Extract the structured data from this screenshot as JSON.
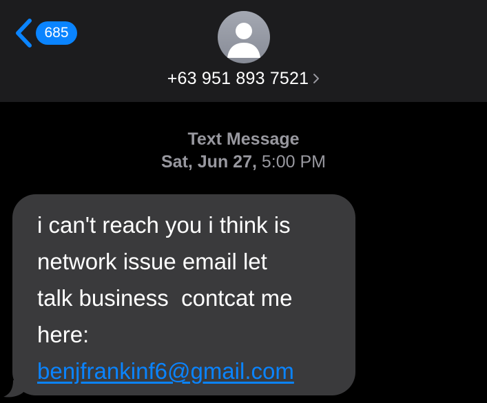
{
  "header": {
    "back_badge": "685",
    "contact_number": "+63 951 893 7521",
    "avatar_icon": "person-silhouette-icon",
    "back_icon": "chevron-left-icon",
    "detail_icon": "chevron-right-icon"
  },
  "thread": {
    "service_label": "Text Message",
    "date_day": "Sat, Jun 27,",
    "date_time": "5:00 PM"
  },
  "message": {
    "lines": [
      "i can't reach you i think is",
      "network issue email let",
      "talk business  contcat me",
      "here:"
    ],
    "email": "benjfrankinf6@gmail.com"
  },
  "colors": {
    "background": "#000000",
    "header_background": "#1c1c1e",
    "accent": "#0a84ff",
    "bubble": "#3a3a3c",
    "meta_text": "#98989f"
  }
}
